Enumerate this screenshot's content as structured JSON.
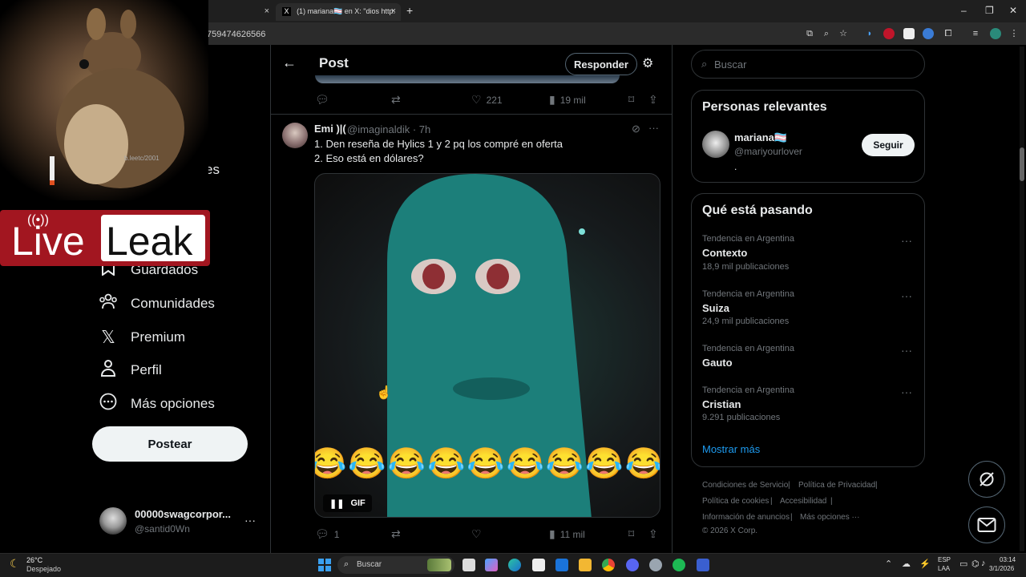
{
  "browser": {
    "tab1_close": "×",
    "tab2_title": "(1) mariana🏳️‍⚧️ en X: \"dios http:",
    "tab2_close": "×",
    "new_tab": "+",
    "url": "759474626566",
    "win_min": "–",
    "win_max": "❐",
    "win_close": "✕"
  },
  "overlay": {
    "live": "Live",
    "leak": "Leak",
    "watermark": "b.leetc/2001"
  },
  "nav": {
    "partial": "es",
    "items": [
      {
        "label": "Guardados",
        "icon": "bookmark-icon"
      },
      {
        "label": "Comunidades",
        "icon": "communities-icon"
      },
      {
        "label": "Premium",
        "icon": "x-logo-icon"
      },
      {
        "label": "Perfil",
        "icon": "profile-icon"
      },
      {
        "label": "Más opciones",
        "icon": "more-circle-icon"
      }
    ],
    "post_button": "Postear",
    "account_name": "00000swagcorpor...",
    "account_handle": "@santid0Wn",
    "account_more": "···"
  },
  "header": {
    "title": "Post",
    "reply_button": "Responder"
  },
  "prev_tweet_actions": {
    "likes": "221",
    "views": "19 mil"
  },
  "tweet": {
    "author_name": "Emi )|(",
    "handle_time": "@imaginaldik · 7h",
    "text_line1": "1. Den reseña de Hylics 1 y 2 pq los compré en oferta",
    "text_line2": "2. Eso está en dólares?",
    "gif_label": "GIF",
    "emoji_row": "😂😂😂😂😂😂😂😂😂",
    "replies": "1",
    "views": "11 mil"
  },
  "search": {
    "placeholder": "Buscar"
  },
  "relevant": {
    "title": "Personas relevantes",
    "name": "mariana🏳️‍⚧️",
    "handle": "@mariyourlover",
    "bio": ".",
    "follow_button": "Seguir"
  },
  "trends": {
    "title": "Qué está pasando",
    "items": [
      {
        "category": "Tendencia en Argentina",
        "name": "Contexto",
        "count": "18,9 mil publicaciones"
      },
      {
        "category": "Tendencia en Argentina",
        "name": "Suiza",
        "count": "24,9 mil publicaciones"
      },
      {
        "category": "Tendencia en Argentina",
        "name": "Gauto",
        "count": ""
      },
      {
        "category": "Tendencia en Argentina",
        "name": "Cristian",
        "count": "9.291 publicaciones"
      }
    ],
    "show_more": "Mostrar más"
  },
  "footer": {
    "terms": "Condiciones de Servicio",
    "privacy": "Política de Privacidad",
    "cookies": "Política de cookies",
    "accessibility": "Accesibilidad",
    "ads": "Información de anuncios",
    "more": "Más opciones ···",
    "copyright": "© 2026 X Corp."
  },
  "taskbar": {
    "temp": "26°C",
    "weather": "Despejado",
    "search": "Buscar",
    "lang1": "ESP",
    "lang2": "LAA",
    "time": "03:14",
    "date": "3/1/2026"
  },
  "colors": {
    "accent": "#1d9bf0",
    "bg": "#000000",
    "text": "#e7e9ea",
    "muted": "#71767b",
    "border": "#2f3336",
    "liveleak_red": "#a21620",
    "gif_teal": "#1c7f7a"
  }
}
